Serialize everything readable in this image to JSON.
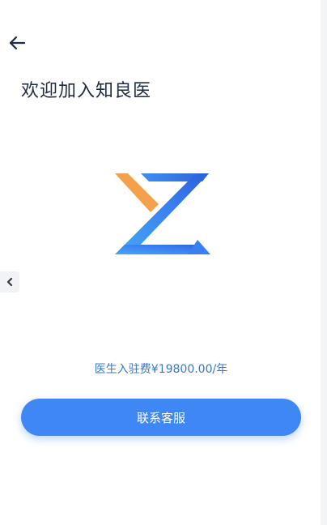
{
  "header": {
    "title": "欢迎加入知良医"
  },
  "fee": {
    "text": "医生入驻费¥19800.00/年"
  },
  "actions": {
    "contact_label": "联系客服"
  },
  "icons": {
    "back": "arrow-left-icon",
    "logo": "zhiliangyi-logo",
    "handle": "chevron-left-icon"
  },
  "colors": {
    "brand_blue": "#3f87f5",
    "fee_text": "#3a78c9",
    "title_text": "#1f2a44",
    "logo_orange": "#f5a04a"
  }
}
